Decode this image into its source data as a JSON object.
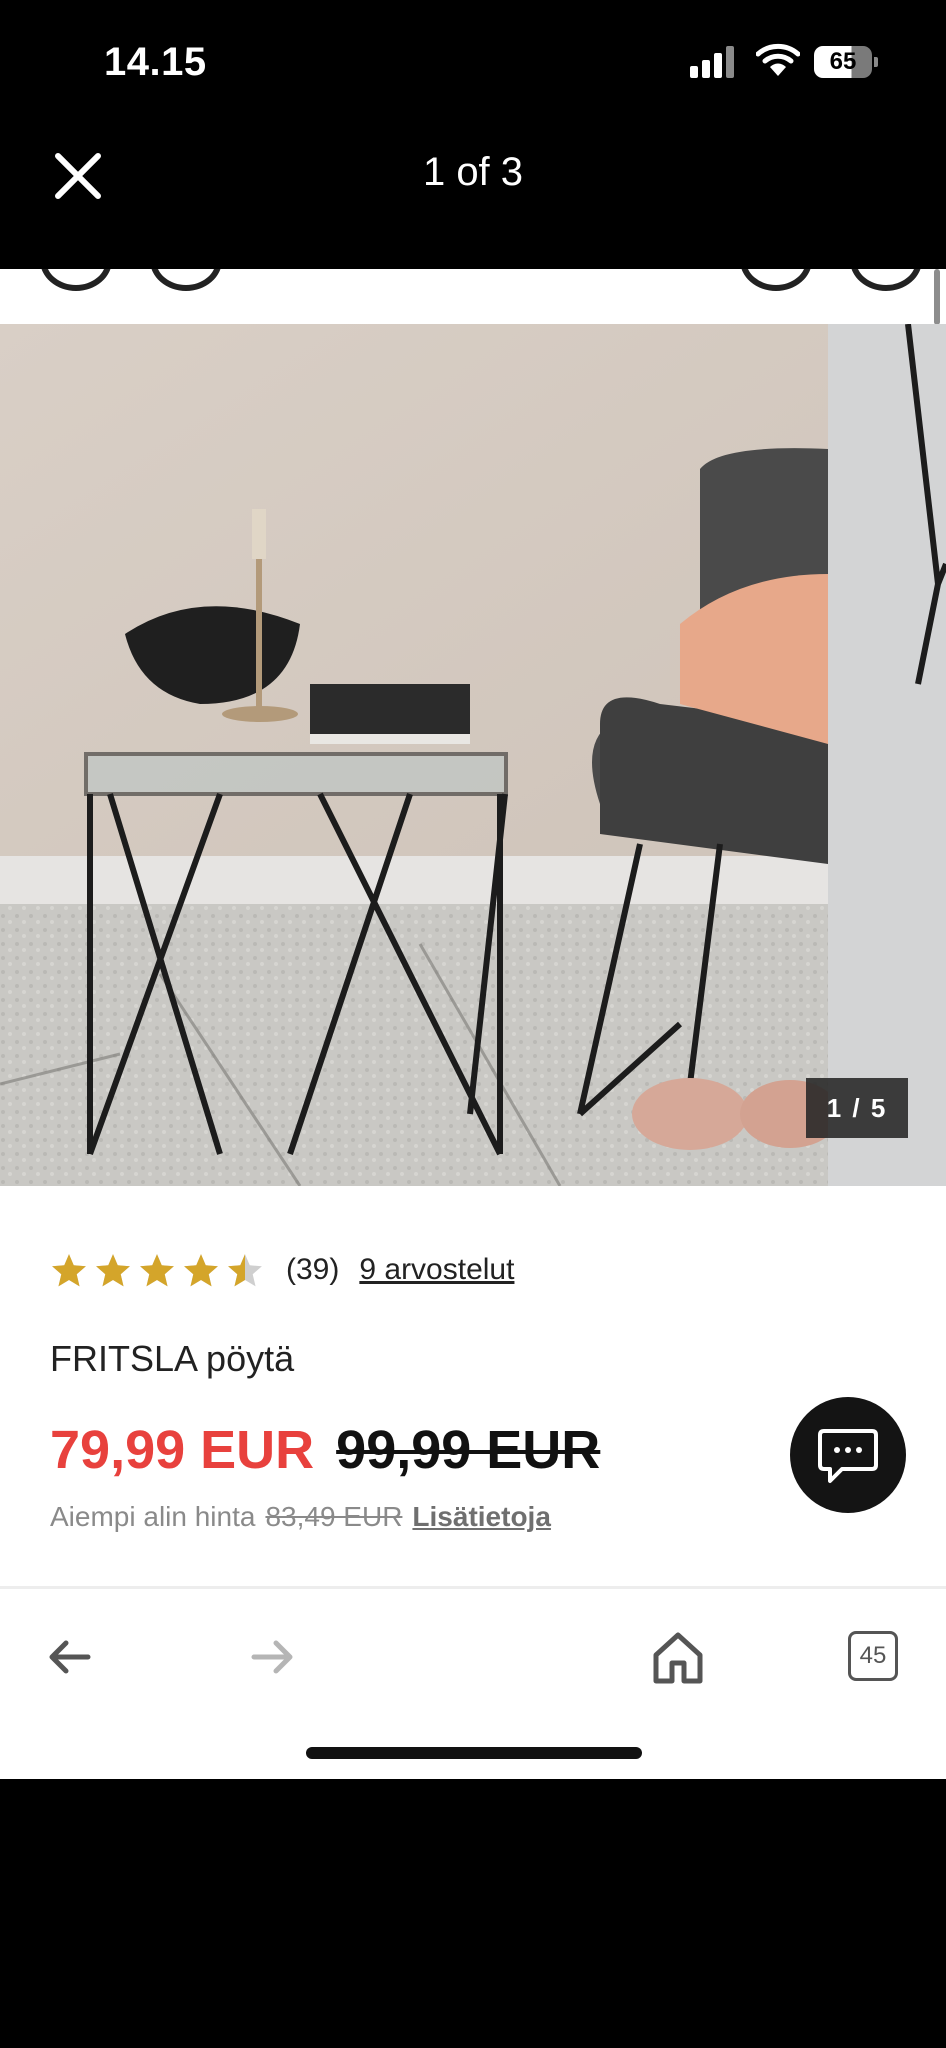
{
  "status_bar": {
    "time": "14.15",
    "battery_level": "65"
  },
  "viewer": {
    "counter": "1 of 3",
    "close_icon": "close-icon"
  },
  "gallery": {
    "image_counter": "1 / 5"
  },
  "product": {
    "rating_value": 4.5,
    "rating_max": 5,
    "rating_count": "(39)",
    "reviews_link": "9 arvostelut",
    "name": "FRITSLA pöytä",
    "price_current": "79,99 EUR",
    "price_old": "99,99 EUR",
    "lowest_label": "Aiempi alin hinta",
    "lowest_price": "83,49 EUR",
    "more_info": "Lisätietoja"
  },
  "toolbar": {
    "back_icon": "arrow-left-icon",
    "forward_icon": "arrow-right-icon",
    "home_icon": "home-icon",
    "tabs_count": "45"
  },
  "colors": {
    "sale_price": "#e8413d",
    "star": "#d4a52a",
    "chat_button": "#141414"
  }
}
